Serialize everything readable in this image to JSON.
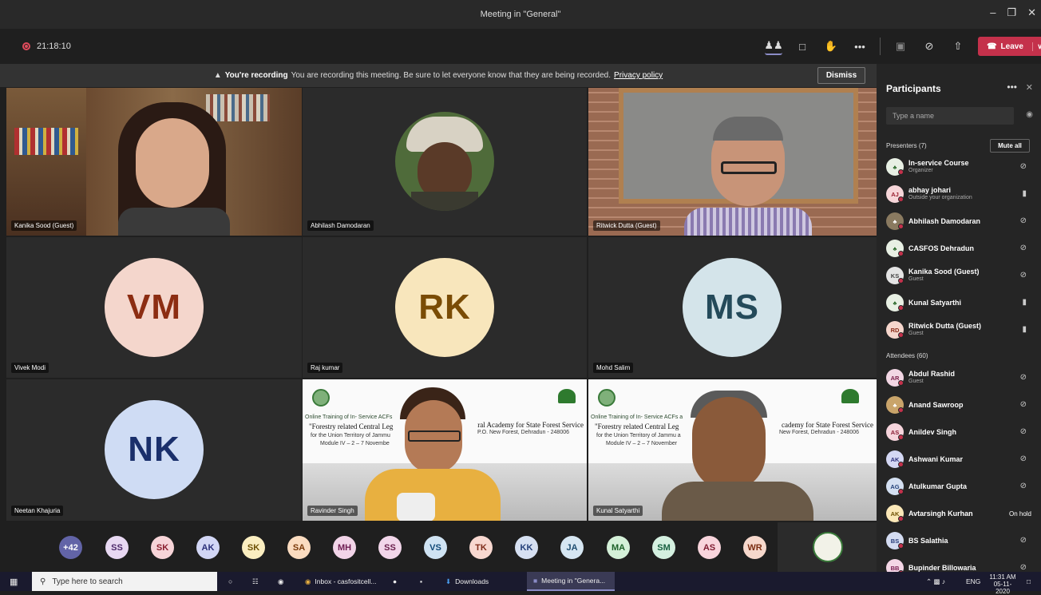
{
  "window": {
    "title": "Meeting in \"General\""
  },
  "toolbar": {
    "timer": "21:18:10",
    "leave_label": "Leave"
  },
  "banner": {
    "title": "You're recording",
    "text": "You are recording this meeting. Be sure to let everyone know that they are being recorded.",
    "link": "Privacy policy",
    "dismiss_label": "Dismiss"
  },
  "tiles": [
    {
      "name": "Kanika Sood (Guest)"
    },
    {
      "name": "Abhilash Damodaran"
    },
    {
      "name": "Ritwick Dutta (Guest)"
    },
    {
      "name": "Vivek Modi",
      "initials": "VM",
      "bg": "#f4d6cc",
      "fg": "#8c2d12"
    },
    {
      "name": "Raj kumar",
      "initials": "RK",
      "bg": "#f8e6bc",
      "fg": "#7a4c05"
    },
    {
      "name": "Mohd Salim",
      "initials": "MS",
      "bg": "#d4e4ea",
      "fg": "#244a5a"
    },
    {
      "name": "Neetan Khajuria",
      "initials": "NK",
      "bg": "#cfdcf4",
      "fg": "#1a2f6b"
    },
    {
      "name": "Ravinder Singh"
    },
    {
      "name": "Kunal Satyarthi"
    }
  ],
  "slide": {
    "line1": "Online Training of In- Service ACFs",
    "line1b": "Online Training of In- Service ACFs a",
    "title_left": "\"Forestry related Central Leg",
    "title_right": "ral Academy for State Forest Service",
    "title_right_b": "cademy for State Forest Service",
    "address": "P.O. New Forest, Dehradun - 248006",
    "address_b": "New Forest, Dehradun - 248006",
    "ut": "for the Union Territory of Jammu",
    "ut_b": "for the Union Territory of Jammu a",
    "module": "Module IV – 2 – 7 Novembe",
    "module_b": "Module IV – 2 – 7 November"
  },
  "strip": [
    {
      "initials": "+42",
      "bg": "#6264a7",
      "fg": "#ffffff"
    },
    {
      "initials": "SS",
      "bg": "#e8d8f2",
      "fg": "#4e2a6b"
    },
    {
      "initials": "SK",
      "bg": "#f7d4d8",
      "fg": "#8a1e2e"
    },
    {
      "initials": "AK",
      "bg": "#d2d6f5",
      "fg": "#2b2f7a"
    },
    {
      "initials": "SK",
      "bg": "#fbeec0",
      "fg": "#6e5105"
    },
    {
      "initials": "SA",
      "bg": "#fbdcc0",
      "fg": "#7a3a0a"
    },
    {
      "initials": "MH",
      "bg": "#f2d4e8",
      "fg": "#6e1c52"
    },
    {
      "initials": "SS",
      "bg": "#f2d6ea",
      "fg": "#6a1e4c"
    },
    {
      "initials": "VS",
      "bg": "#cfe3f3",
      "fg": "#114a78"
    },
    {
      "initials": "TK",
      "bg": "#f8d8d0",
      "fg": "#7e2c1a"
    },
    {
      "initials": "KK",
      "bg": "#d6e0f2",
      "fg": "#25407a"
    },
    {
      "initials": "JA",
      "bg": "#d6e6f2",
      "fg": "#1e4d70"
    },
    {
      "initials": "MA",
      "bg": "#d4f0d8",
      "fg": "#1c6128"
    },
    {
      "initials": "SM",
      "bg": "#d4f0e0",
      "fg": "#176040"
    },
    {
      "initials": "AS",
      "bg": "#f8d4dc",
      "fg": "#7e1a30"
    },
    {
      "initials": "WR",
      "bg": "#f6d8cc",
      "fg": "#7a2c10"
    }
  ],
  "panel": {
    "title": "Participants",
    "search_placeholder": "Type a name",
    "presenters_header": "Presenters (7)",
    "mute_all": "Mute all",
    "attendees_header": "Attendees (60)",
    "presenters": [
      {
        "name": "In-service Course",
        "sub": "Organizer",
        "initials": "",
        "bg": "#e8f0e4",
        "fg": "#2e6b2e",
        "status": "muted"
      },
      {
        "name": "abhay johari",
        "sub": "Outside your organization",
        "initials": "AJ",
        "bg": "#f7d6d9",
        "fg": "#9a2333",
        "status": "mic"
      },
      {
        "name": "Abhilash Damodaran",
        "sub": "",
        "initials": "",
        "bg": "#8a7a60",
        "fg": "#ffffff",
        "status": "muted"
      },
      {
        "name": "CASFOS Dehradun",
        "sub": "",
        "initials": "",
        "bg": "#e8f0e4",
        "fg": "#2e6b2e",
        "status": "muted"
      },
      {
        "name": "Kanika Sood (Guest)",
        "sub": "Guest",
        "initials": "KS",
        "bg": "#e4e4e4",
        "fg": "#444444",
        "status": "muted"
      },
      {
        "name": "Kunal Satyarthi",
        "sub": "",
        "initials": "",
        "bg": "#e8f0e4",
        "fg": "#2e6b2e",
        "status": "mic"
      },
      {
        "name": "Ritwick Dutta (Guest)",
        "sub": "Guest",
        "initials": "RD",
        "bg": "#f6d6cc",
        "fg": "#8a2c18",
        "status": "mic"
      }
    ],
    "attendees": [
      {
        "name": "Abdul Rashid",
        "sub": "Guest",
        "initials": "AR",
        "bg": "#f2d6e4",
        "fg": "#7a1e4a",
        "status": "muted"
      },
      {
        "name": "Anand Sawroop",
        "sub": "",
        "initials": "",
        "bg": "#c9a46a",
        "fg": "#ffffff",
        "status": "muted"
      },
      {
        "name": "Anildev Singh",
        "sub": "",
        "initials": "AS",
        "bg": "#f6d4dc",
        "fg": "#8a1e34",
        "status": "muted"
      },
      {
        "name": "Ashwani Kumar",
        "sub": "",
        "initials": "AK",
        "bg": "#d4d8f4",
        "fg": "#2b2f7a",
        "status": "muted"
      },
      {
        "name": "Atulkumar Gupta",
        "sub": "",
        "initials": "AG",
        "bg": "#d4e0f2",
        "fg": "#23427a",
        "status": "muted"
      },
      {
        "name": "Avtarsingh Kurhan",
        "sub": "",
        "initials": "AK",
        "bg": "#fbe8b8",
        "fg": "#6e5105",
        "status": "hold",
        "hold_label": "On hold"
      },
      {
        "name": "BS Salathia",
        "sub": "",
        "initials": "BS",
        "bg": "#d4dcf2",
        "fg": "#253a78",
        "status": "muted"
      },
      {
        "name": "Bupinder Billowaria",
        "sub": "",
        "initials": "BB",
        "bg": "#f4d6e6",
        "fg": "#7a1e52",
        "status": "muted"
      }
    ]
  },
  "taskbar": {
    "search_placeholder": "Type here to search",
    "items": [
      "Inbox - casfositcell...",
      "Downloads",
      "Meeting in \"Genera..."
    ],
    "lang": "ENG",
    "time": "11:31 AM",
    "date": "05-11-2020"
  },
  "colors": {
    "accent": "#6264a7",
    "leave": "#c4314b",
    "background": "#1f1f1f"
  }
}
